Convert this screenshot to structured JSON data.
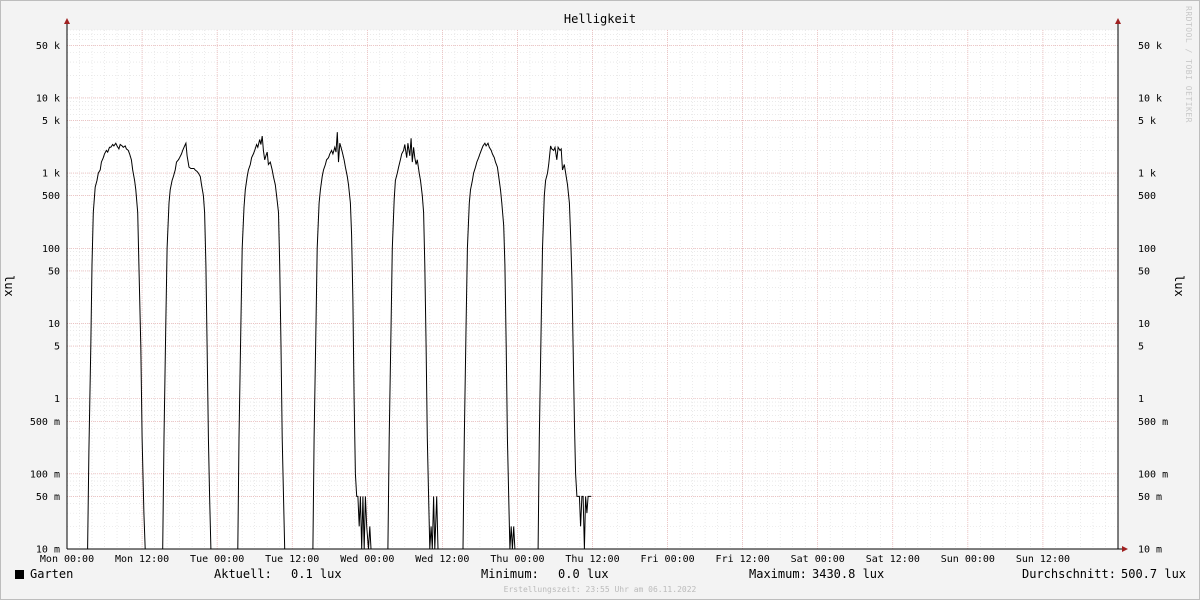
{
  "chart_data": {
    "type": "line",
    "title": "Helligkeit",
    "ylabel": "lux",
    "yscale": "log",
    "ylim": [
      0.01,
      80000
    ],
    "y_ticks": [
      {
        "value": 0.01,
        "label": "10 m"
      },
      {
        "value": 0.05,
        "label": "50 m"
      },
      {
        "value": 0.1,
        "label": "100 m"
      },
      {
        "value": 0.5,
        "label": "500 m"
      },
      {
        "value": 1,
        "label": "1"
      },
      {
        "value": 5,
        "label": "5"
      },
      {
        "value": 10,
        "label": "10"
      },
      {
        "value": 50,
        "label": "50"
      },
      {
        "value": 100,
        "label": "100"
      },
      {
        "value": 500,
        "label": "500"
      },
      {
        "value": 1000,
        "label": "1 k"
      },
      {
        "value": 5000,
        "label": "5 k"
      },
      {
        "value": 10000,
        "label": "10 k"
      },
      {
        "value": 50000,
        "label": "50 k"
      }
    ],
    "x_unit": "hours since Mon 00:00",
    "xlim": [
      0,
      168
    ],
    "x_ticks": [
      {
        "value": 0,
        "label": "Mon 00:00"
      },
      {
        "value": 12,
        "label": "Mon 12:00"
      },
      {
        "value": 24,
        "label": "Tue 00:00"
      },
      {
        "value": 36,
        "label": "Tue 12:00"
      },
      {
        "value": 48,
        "label": "Wed 00:00"
      },
      {
        "value": 60,
        "label": "Wed 12:00"
      },
      {
        "value": 72,
        "label": "Thu 00:00"
      },
      {
        "value": 84,
        "label": "Thu 12:00"
      },
      {
        "value": 96,
        "label": "Fri 00:00"
      },
      {
        "value": 108,
        "label": "Fri 12:00"
      },
      {
        "value": 120,
        "label": "Sat 00:00"
      },
      {
        "value": 132,
        "label": "Sat 12:00"
      },
      {
        "value": 144,
        "label": "Sun 00:00"
      },
      {
        "value": 156,
        "label": "Sun 12:00"
      }
    ],
    "grid": true,
    "series": [
      {
        "name": "Garten",
        "color": "#000000",
        "points": [
          [
            0,
            0.01
          ],
          [
            3.3,
            0.01
          ],
          [
            3.5,
            0.2
          ],
          [
            3.8,
            5
          ],
          [
            4.0,
            60
          ],
          [
            4.2,
            300
          ],
          [
            4.5,
            650
          ],
          [
            4.8,
            800
          ],
          [
            5.0,
            1000
          ],
          [
            5.3,
            1100
          ],
          [
            5.5,
            1400
          ],
          [
            5.8,
            1600
          ],
          [
            6.0,
            1800
          ],
          [
            6.3,
            2000
          ],
          [
            6.5,
            1900
          ],
          [
            6.8,
            2200
          ],
          [
            7.0,
            2200
          ],
          [
            7.3,
            2400
          ],
          [
            7.5,
            2300
          ],
          [
            7.8,
            2500
          ],
          [
            8.0,
            2300
          ],
          [
            8.3,
            2100
          ],
          [
            8.5,
            2400
          ],
          [
            8.8,
            2300
          ],
          [
            9.0,
            2200
          ],
          [
            9.3,
            2300
          ],
          [
            9.5,
            2100
          ],
          [
            9.8,
            2000
          ],
          [
            10.0,
            1800
          ],
          [
            10.3,
            1500
          ],
          [
            10.5,
            1100
          ],
          [
            10.8,
            800
          ],
          [
            11.0,
            600
          ],
          [
            11.3,
            300
          ],
          [
            11.5,
            60
          ],
          [
            11.8,
            5
          ],
          [
            12.0,
            0.3
          ],
          [
            12.3,
            0.03
          ],
          [
            12.5,
            0.01
          ],
          [
            15.3,
            0.01
          ],
          [
            15.5,
            0.3
          ],
          [
            15.8,
            10
          ],
          [
            16.0,
            100
          ],
          [
            16.3,
            400
          ],
          [
            16.5,
            600
          ],
          [
            16.8,
            800
          ],
          [
            17.0,
            900
          ],
          [
            17.3,
            1100
          ],
          [
            17.5,
            1400
          ],
          [
            17.8,
            1500
          ],
          [
            18.0,
            1600
          ],
          [
            18.3,
            1800
          ],
          [
            18.5,
            2000
          ],
          [
            18.8,
            2300
          ],
          [
            19.0,
            2500
          ],
          [
            19.2,
            1700
          ],
          [
            19.5,
            1200
          ],
          [
            19.8,
            1150
          ],
          [
            20.0,
            1150
          ],
          [
            20.3,
            1150
          ],
          [
            20.5,
            1100
          ],
          [
            20.8,
            1050
          ],
          [
            21.0,
            1000
          ],
          [
            21.3,
            900
          ],
          [
            21.5,
            700
          ],
          [
            21.8,
            500
          ],
          [
            22.0,
            300
          ],
          [
            22.2,
            60
          ],
          [
            22.4,
            5
          ],
          [
            22.6,
            0.3
          ],
          [
            22.8,
            0.05
          ],
          [
            23.0,
            0.01
          ],
          [
            27.3,
            0.01
          ],
          [
            27.5,
            0.3
          ],
          [
            27.8,
            10
          ],
          [
            28.0,
            100
          ],
          [
            28.3,
            350
          ],
          [
            28.5,
            600
          ],
          [
            28.8,
            900
          ],
          [
            29.0,
            1100
          ],
          [
            29.3,
            1300
          ],
          [
            29.5,
            1600
          ],
          [
            29.8,
            1800
          ],
          [
            30.0,
            2000
          ],
          [
            30.3,
            2400
          ],
          [
            30.5,
            2200
          ],
          [
            30.8,
            2800
          ],
          [
            31.0,
            2400
          ],
          [
            31.2,
            3100
          ],
          [
            31.4,
            2000
          ],
          [
            31.6,
            1500
          ],
          [
            31.8,
            1700
          ],
          [
            32.0,
            1900
          ],
          [
            32.2,
            1300
          ],
          [
            32.5,
            1400
          ],
          [
            32.8,
            1100
          ],
          [
            33.0,
            900
          ],
          [
            33.3,
            700
          ],
          [
            33.5,
            500
          ],
          [
            33.8,
            300
          ],
          [
            34.0,
            60
          ],
          [
            34.2,
            5
          ],
          [
            34.4,
            0.3
          ],
          [
            34.6,
            0.05
          ],
          [
            34.8,
            0.01
          ],
          [
            39.3,
            0.01
          ],
          [
            39.5,
            0.3
          ],
          [
            39.8,
            10
          ],
          [
            40.0,
            100
          ],
          [
            40.3,
            400
          ],
          [
            40.5,
            600
          ],
          [
            40.8,
            900
          ],
          [
            41.0,
            1100
          ],
          [
            41.3,
            1300
          ],
          [
            41.5,
            1500
          ],
          [
            41.8,
            1600
          ],
          [
            42.0,
            1800
          ],
          [
            42.3,
            2000
          ],
          [
            42.5,
            1800
          ],
          [
            42.8,
            2200
          ],
          [
            43.0,
            1900
          ],
          [
            43.2,
            3500
          ],
          [
            43.4,
            1400
          ],
          [
            43.6,
            2500
          ],
          [
            43.8,
            2200
          ],
          [
            44.0,
            1900
          ],
          [
            44.3,
            1500
          ],
          [
            44.5,
            1200
          ],
          [
            44.8,
            900
          ],
          [
            45.0,
            700
          ],
          [
            45.3,
            400
          ],
          [
            45.5,
            150
          ],
          [
            45.7,
            20
          ],
          [
            45.9,
            1
          ],
          [
            46.1,
            0.1
          ],
          [
            46.3,
            0.05
          ],
          [
            46.5,
            0.05
          ],
          [
            46.7,
            0.02
          ],
          [
            46.9,
            0.05
          ],
          [
            47.1,
            0.01
          ],
          [
            47.3,
            0.05
          ],
          [
            47.5,
            0.01
          ],
          [
            47.7,
            0.05
          ],
          [
            47.9,
            0.02
          ],
          [
            48.2,
            0.01
          ],
          [
            48.4,
            0.02
          ],
          [
            48.6,
            0.01
          ],
          [
            51.3,
            0.01
          ],
          [
            51.5,
            0.3
          ],
          [
            51.8,
            10
          ],
          [
            52.0,
            100
          ],
          [
            52.3,
            450
          ],
          [
            52.5,
            800
          ],
          [
            52.8,
            1000
          ],
          [
            53.0,
            1200
          ],
          [
            53.3,
            1500
          ],
          [
            53.5,
            1800
          ],
          [
            53.8,
            2000
          ],
          [
            54.0,
            2400
          ],
          [
            54.3,
            1600
          ],
          [
            54.5,
            2500
          ],
          [
            54.8,
            1700
          ],
          [
            55.0,
            2900
          ],
          [
            55.2,
            1400
          ],
          [
            55.4,
            2200
          ],
          [
            55.6,
            1600
          ],
          [
            55.8,
            1300
          ],
          [
            56.0,
            1500
          ],
          [
            56.3,
            1000
          ],
          [
            56.5,
            800
          ],
          [
            56.8,
            500
          ],
          [
            57.0,
            300
          ],
          [
            57.2,
            60
          ],
          [
            57.4,
            5
          ],
          [
            57.6,
            0.3
          ],
          [
            57.8,
            0.05
          ],
          [
            58.0,
            0.01
          ],
          [
            58.2,
            0.02
          ],
          [
            58.4,
            0.01
          ],
          [
            58.6,
            0.05
          ],
          [
            58.8,
            0.01
          ],
          [
            59.1,
            0.05
          ],
          [
            59.3,
            0.01
          ],
          [
            63.3,
            0.01
          ],
          [
            63.5,
            0.3
          ],
          [
            63.8,
            10
          ],
          [
            64.0,
            100
          ],
          [
            64.3,
            400
          ],
          [
            64.5,
            600
          ],
          [
            64.8,
            800
          ],
          [
            65.0,
            1000
          ],
          [
            65.3,
            1200
          ],
          [
            65.5,
            1400
          ],
          [
            65.8,
            1600
          ],
          [
            66.0,
            1800
          ],
          [
            66.3,
            2100
          ],
          [
            66.5,
            2300
          ],
          [
            66.8,
            2500
          ],
          [
            67.0,
            2300
          ],
          [
            67.3,
            2500
          ],
          [
            67.5,
            2200
          ],
          [
            67.8,
            2000
          ],
          [
            68.0,
            1800
          ],
          [
            68.3,
            1600
          ],
          [
            68.5,
            1400
          ],
          [
            68.8,
            1200
          ],
          [
            69.0,
            900
          ],
          [
            69.3,
            600
          ],
          [
            69.5,
            400
          ],
          [
            69.8,
            200
          ],
          [
            70.0,
            60
          ],
          [
            70.2,
            5
          ],
          [
            70.4,
            0.3
          ],
          [
            70.6,
            0.05
          ],
          [
            70.8,
            0.01
          ],
          [
            71.0,
            0.02
          ],
          [
            71.2,
            0.01
          ],
          [
            71.4,
            0.02
          ],
          [
            71.6,
            0.01
          ],
          [
            75.3,
            0.01
          ],
          [
            75.5,
            0.3
          ],
          [
            75.8,
            10
          ],
          [
            76.0,
            100
          ],
          [
            76.3,
            500
          ],
          [
            76.5,
            800
          ],
          [
            76.8,
            1000
          ],
          [
            77.0,
            1300
          ],
          [
            77.3,
            2300
          ],
          [
            77.5,
            2100
          ],
          [
            77.8,
            2000
          ],
          [
            78.0,
            2200
          ],
          [
            78.3,
            1500
          ],
          [
            78.5,
            2200
          ],
          [
            78.8,
            2000
          ],
          [
            79.0,
            2100
          ],
          [
            79.2,
            1100
          ],
          [
            79.5,
            1300
          ],
          [
            79.8,
            900
          ],
          [
            80.0,
            700
          ],
          [
            80.3,
            400
          ],
          [
            80.5,
            150
          ],
          [
            80.7,
            40
          ],
          [
            80.9,
            5
          ],
          [
            81.1,
            0.5
          ],
          [
            81.3,
            0.1
          ],
          [
            81.5,
            0.05
          ],
          [
            81.7,
            0.05
          ],
          [
            81.9,
            0.05
          ],
          [
            82.1,
            0.02
          ],
          [
            82.3,
            0.05
          ],
          [
            82.5,
            0.05
          ],
          [
            82.7,
            0.01
          ],
          [
            82.9,
            0.05
          ],
          [
            83.1,
            0.03
          ],
          [
            83.3,
            0.05
          ],
          [
            83.5,
            0.05
          ],
          [
            83.8,
            0.05
          ]
        ]
      }
    ],
    "legend": {
      "series_label": "Garten",
      "current_label": "Aktuell:",
      "current_value": "0.1 lux",
      "min_label": "Minimum:",
      "min_value": "0.0 lux",
      "max_label": "Maximum:",
      "max_value": "3430.8 lux",
      "avg_label": "Durchschnitt:",
      "avg_value": "500.7 lux"
    },
    "footer": "Erstellungszeit: 23:55 Uhr am 06.11.2022",
    "watermark": "RRDTOOL / TOBI OETIKER"
  }
}
